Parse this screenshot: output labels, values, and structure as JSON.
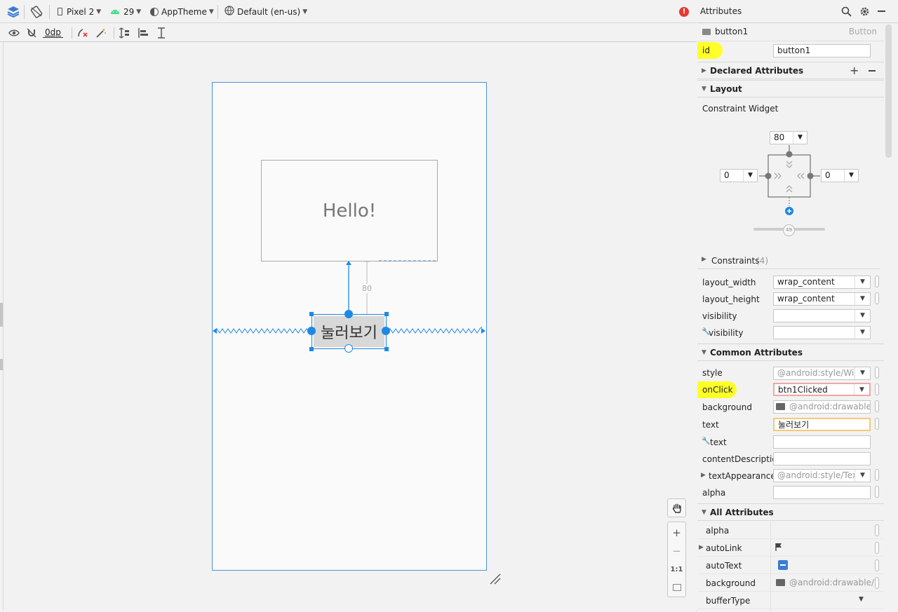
{
  "toolbar": {
    "device": "Pixel 2",
    "api_level": "29",
    "theme": "AppTheme",
    "locale": "Default (en-us)",
    "default_margin": "0dp"
  },
  "canvas": {
    "hello_text": "Hello!",
    "button_text": "눌러보기",
    "margin_label": "80",
    "zoom_one_to_one": "1:1"
  },
  "attributes": {
    "title": "Attributes",
    "component_name": "button1",
    "component_type": "Button",
    "id_label": "id",
    "id_value": "button1",
    "declared_attributes_label": "Declared Attributes",
    "layout_label": "Layout",
    "constraint_widget_label": "Constraint Widget",
    "constraint_top": "80",
    "constraint_left": "0",
    "constraint_right": "0",
    "bias_value": "49",
    "constraints_label": "Constraints",
    "constraints_count": "(4)",
    "layout_width_label": "layout_width",
    "layout_width_value": "wrap_content",
    "layout_height_label": "layout_height",
    "layout_height_value": "wrap_content",
    "visibility_label": "visibility",
    "visibility_tools_label": "visibility",
    "common_attributes_label": "Common Attributes",
    "style_label": "style",
    "style_value": "@android:style/Wic",
    "onclick_label": "onClick",
    "onclick_value": "btn1Clicked",
    "background_label": "background",
    "background_value": "@android:drawable/b",
    "text_label": "text",
    "text_value": "눌러보기",
    "text_tools_label": "text",
    "content_description_label": "contentDescription",
    "text_appearance_label": "textAppearance",
    "text_appearance_value": "@android:style/Tex",
    "alpha_label": "alpha",
    "all_attributes_label": "All Attributes",
    "all_rows": [
      {
        "label": "alpha",
        "value": ""
      },
      {
        "label": "autoLink",
        "value": ""
      },
      {
        "label": "autoText",
        "value": ""
      },
      {
        "label": "background",
        "value": "@android:drawable/b"
      },
      {
        "label": "bufferType",
        "value": ""
      }
    ]
  },
  "colors": {
    "accent": "#1e88e5",
    "highlight": "#ffff00",
    "error": "#e53935"
  }
}
